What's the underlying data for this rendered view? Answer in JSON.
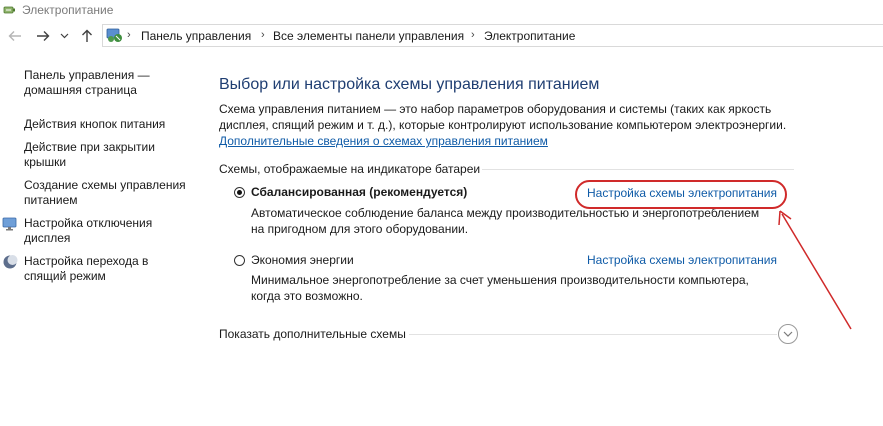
{
  "window": {
    "title": "Электропитание",
    "icon": "power-options-icon"
  },
  "nav": {
    "back_icon": "arrow-left-icon",
    "forward_icon": "arrow-right-icon",
    "recent_icon": "chevron-down-icon",
    "up_icon": "arrow-up-icon",
    "breadcrumb": [
      "Панель управления",
      "Все элементы панели управления",
      "Электропитание"
    ],
    "separator": "›"
  },
  "sidebar": {
    "items": [
      {
        "label": "Панель управления — домашняя страница",
        "icon": null
      },
      {
        "label": "Действия кнопок питания",
        "icon": null
      },
      {
        "label": "Действие при закрытии крышки",
        "icon": null
      },
      {
        "label": "Создание схемы управления питанием",
        "icon": null
      },
      {
        "label": "Настройка отключения дисплея",
        "icon": "display-monitor-icon"
      },
      {
        "label": "Настройка перехода в спящий режим",
        "icon": "sleep-moon-icon"
      }
    ]
  },
  "main": {
    "title": "Выбор или настройка схемы управления питанием",
    "description": "Схема управления питанием — это набор параметров оборудования и системы (таких как яркость дисплея, спящий режим и т. д.), которые контролируют использование компьютером электроэнергии.",
    "more_info_link": "Дополнительные сведения о схемах управления питанием",
    "section_label": "Схемы, отображаемые на индикаторе батареи",
    "plans": [
      {
        "name": "Сбалансированная (рекомендуется)",
        "selected": true,
        "link": "Настройка схемы электропитания",
        "description": "Автоматическое соблюдение баланса между производительностью и энергопотреблением на пригодном для этого оборудовании."
      },
      {
        "name": "Экономия энергии",
        "selected": false,
        "link": "Настройка схемы электропитания",
        "description": "Минимальное энергопотребление за счет уменьшения производительности компьютера, когда это возможно."
      }
    ],
    "show_more": "Показать дополнительные схемы",
    "expand_icon": "chevron-down-circle-icon"
  },
  "annotation": {
    "color": "#d02a2a"
  }
}
